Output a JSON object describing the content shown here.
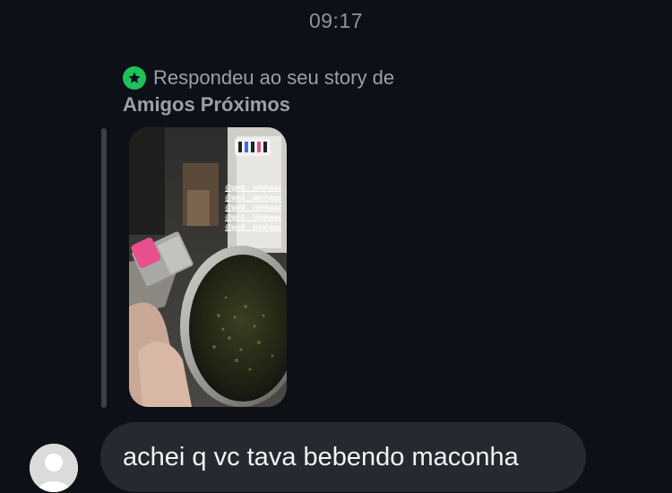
{
  "status": {
    "time": "09:17"
  },
  "reply": {
    "line1": "Respondeu ao seu story de",
    "line2": "Amigos Próximos",
    "badge_icon": "star-icon",
    "badge_color": "#1fc15a"
  },
  "story": {
    "mentions": [
      "@pvd__isinhaax",
      "@pvd__isinhaax",
      "@pvd__isinhaax",
      "@pvd__isinhaax",
      "@pvd__isinhaax"
    ]
  },
  "message": {
    "text": "achei q vc tava bebendo maconha",
    "avatar_icon": "default-avatar-icon"
  },
  "colors": {
    "background": "#0d1117",
    "bubble": "#262a30",
    "muted_text": "#9aa0a8"
  }
}
